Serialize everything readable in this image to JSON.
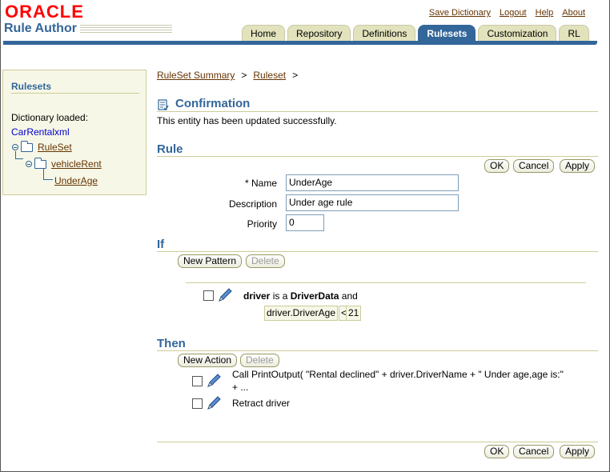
{
  "brand": {
    "logo": "ORACLE",
    "app_title": "Rule Author"
  },
  "global_links": [
    "Save Dictionary",
    "Logout",
    "Help",
    "About"
  ],
  "tabs": [
    {
      "label": "Home"
    },
    {
      "label": "Repository"
    },
    {
      "label": "Definitions"
    },
    {
      "label": "Rulesets",
      "active": true
    },
    {
      "label": "Customization"
    },
    {
      "label": "RL"
    }
  ],
  "sidebar": {
    "title": "Rulesets",
    "dict_label": "Dictionary loaded:",
    "dict_name": "CarRentalxml",
    "tree": [
      {
        "label": "RuleSet",
        "depth": 0
      },
      {
        "label": "vehicleRent",
        "depth": 1
      },
      {
        "label": "UnderAge",
        "depth": 2
      }
    ]
  },
  "breadcrumb": {
    "items": [
      "RuleSet Summary",
      "Ruleset"
    ],
    "separator": ">"
  },
  "confirmation": {
    "title": "Confirmation",
    "message": "This entity has been updated successfully."
  },
  "rule": {
    "title": "Rule",
    "buttons": {
      "ok": "OK",
      "cancel": "Cancel",
      "apply": "Apply"
    },
    "name_label": "* Name",
    "name_value": "UnderAge",
    "description_label": "Description",
    "description_value": "Under age rule",
    "priority_label": "Priority",
    "priority_value": "0"
  },
  "if_section": {
    "title": "If",
    "new_pattern": "New Pattern",
    "delete": "Delete",
    "pattern": {
      "var": "driver",
      "is_a": "is a",
      "type": "DriverData",
      "and": "and"
    },
    "test": {
      "field": "driver.DriverAge",
      "op": "<",
      "value": "21"
    }
  },
  "then_section": {
    "title": "Then",
    "new_action": "New Action",
    "delete": "Delete",
    "actions": [
      "Call PrintOutput( \"Rental declined\" + driver.DriverName + \" Under age,age is:\"",
      "+ ...",
      "Retract driver"
    ]
  },
  "footer_buttons": {
    "ok": "OK",
    "cancel": "Cancel",
    "apply": "Apply"
  },
  "colors": {
    "accent": "#336699",
    "link": "#663300",
    "brand": "#ff0000",
    "panel": "#f7f7e7",
    "tab": "#e2e2bd"
  }
}
